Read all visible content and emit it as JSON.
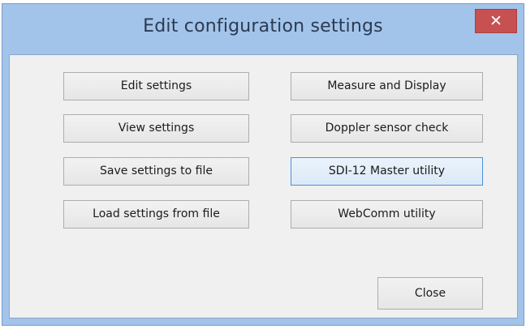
{
  "window": {
    "title": "Edit configuration settings",
    "close_glyph": "✕"
  },
  "buttons": {
    "edit_settings": "Edit settings",
    "view_settings": "View settings",
    "save_settings": "Save settings to file",
    "load_settings": "Load settings from file",
    "measure_display": "Measure and Display",
    "doppler_check": "Doppler sensor check",
    "sdi12_master": "SDI-12 Master utility",
    "webcomm": "WebComm utility",
    "close": "Close"
  },
  "colors": {
    "frame": "#a3c4ea",
    "close_button": "#c75050",
    "client_background": "#f0f0f0",
    "focus_border": "#4c90d8"
  }
}
